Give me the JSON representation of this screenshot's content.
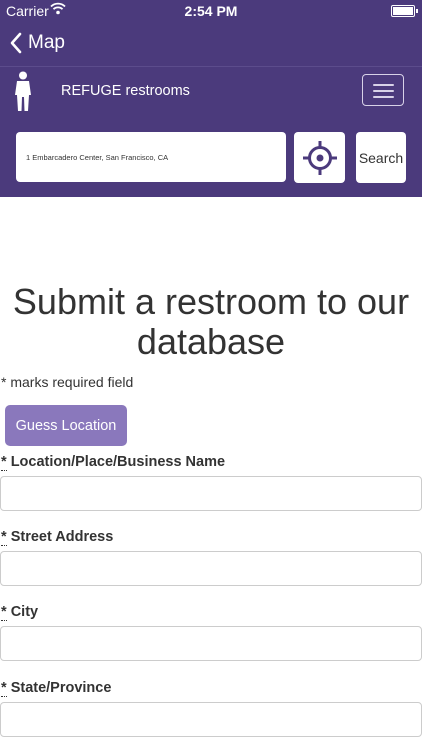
{
  "status_bar": {
    "carrier": "Carrier",
    "time": "2:54 PM"
  },
  "nav": {
    "back_label": "Map"
  },
  "brand": {
    "title": "REFUGE restrooms"
  },
  "search": {
    "value": "1 Embarcadero Center, San Francisco, CA",
    "button_label": "Search"
  },
  "form": {
    "title": "Submit a restroom to our database",
    "required_note": "* marks required field",
    "guess_location_label": "Guess Location",
    "required_marker": "*",
    "fields": [
      {
        "label": "Location/Place/Business Name",
        "value": ""
      },
      {
        "label": "Street Address",
        "value": ""
      },
      {
        "label": "City",
        "value": ""
      },
      {
        "label": "State/Province",
        "value": ""
      }
    ]
  },
  "colors": {
    "header_bg": "#4b3a7c",
    "accent_button": "#8a78bc",
    "locate_icon": "#4b3a7c"
  },
  "icons": {
    "back": "chevron-left-icon",
    "logo": "person-icon",
    "menu": "hamburger-icon",
    "locate": "crosshair-icon",
    "wifi": "wifi-icon",
    "battery": "battery-icon"
  }
}
